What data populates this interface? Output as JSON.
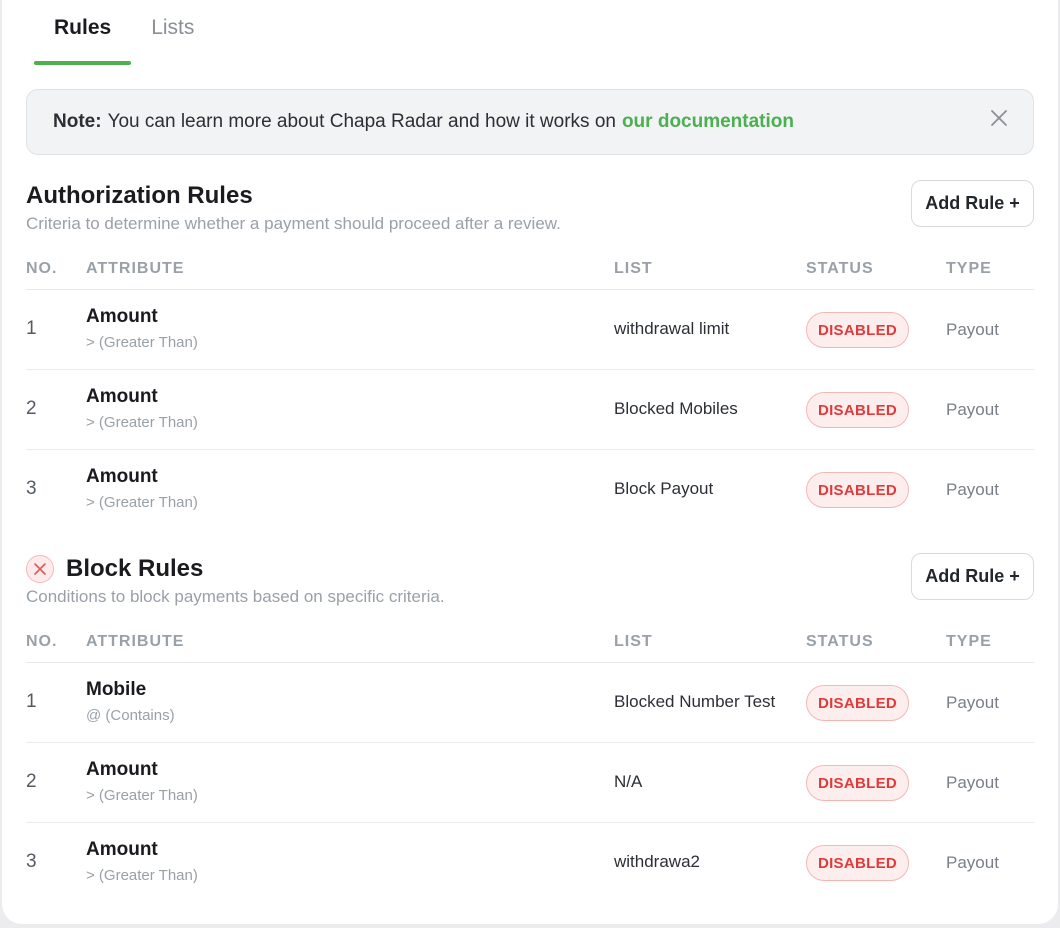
{
  "tabs": [
    {
      "label": "Rules",
      "active": true
    },
    {
      "label": "Lists",
      "active": false
    }
  ],
  "note": {
    "prefix": "Note:",
    "text": "You can learn more about Chapa Radar and how it works on",
    "link": "our documentation"
  },
  "columns": {
    "no": "NO.",
    "attribute": "ATTRIBUTE",
    "list": "LIST",
    "status": "STATUS",
    "type": "TYPE"
  },
  "authorization": {
    "title": "Authorization Rules",
    "description": "Criteria to determine whether a payment should proceed after a review.",
    "add_label": "Add Rule +",
    "rows": [
      {
        "no": "1",
        "attribute": "Amount",
        "operator": "> (Greater Than)",
        "list": "withdrawal limit",
        "status": "DISABLED",
        "type": "Payout"
      },
      {
        "no": "2",
        "attribute": "Amount",
        "operator": "> (Greater Than)",
        "list": "Blocked Mobiles",
        "status": "DISABLED",
        "type": "Payout"
      },
      {
        "no": "3",
        "attribute": "Amount",
        "operator": "> (Greater Than)",
        "list": "Block Payout",
        "status": "DISABLED",
        "type": "Payout"
      }
    ]
  },
  "block": {
    "title": "Block Rules",
    "description": "Conditions to block payments based on specific criteria.",
    "add_label": "Add Rule +",
    "rows": [
      {
        "no": "1",
        "attribute": "Mobile",
        "operator": "@ (Contains)",
        "list": "Blocked Number Test",
        "status": "DISABLED",
        "type": "Payout"
      },
      {
        "no": "2",
        "attribute": "Amount",
        "operator": "> (Greater Than)",
        "list": "N/A",
        "status": "DISABLED",
        "type": "Payout"
      },
      {
        "no": "3",
        "attribute": "Amount",
        "operator": "> (Greater Than)",
        "list": "withdrawa2",
        "status": "DISABLED",
        "type": "Payout"
      }
    ]
  },
  "colors": {
    "accent": "#4caf50",
    "status_disabled": "#e03b3b"
  },
  "icons": {
    "close": "close-icon",
    "block": "x-circle-icon"
  }
}
